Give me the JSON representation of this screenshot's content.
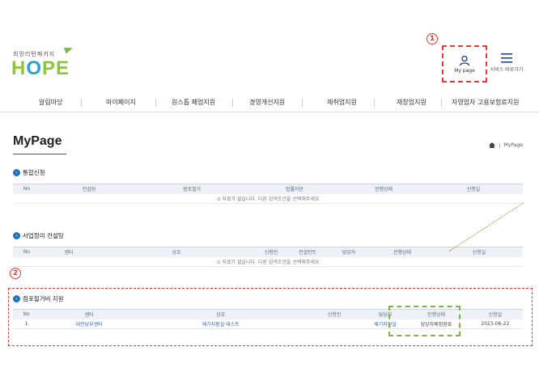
{
  "header": {
    "logo_sub": "희망리턴패키지",
    "logo_main_h": "H",
    "logo_main_o": "O",
    "logo_main_pe": "PE",
    "mypage_label": "My page",
    "menu_label": "서비스 바로가기"
  },
  "markers": {
    "one": "1",
    "two": "2"
  },
  "nav": [
    "알림마당",
    "마이페이지",
    "원스톱 폐업지원",
    "경영개선지원",
    "재취업지원",
    "재창업지원",
    "자영업자 고용보험료지원"
  ],
  "page": {
    "title": "MyPage",
    "breadcrumb_home": "home-icon",
    "breadcrumb_current": "MyPage"
  },
  "sections": {
    "integrated": {
      "title": "통합신청",
      "columns": [
        "No",
        "컨설팅",
        "점포철거",
        "법률자문",
        "진행상태",
        "신청일"
      ],
      "empty": "⊙ 자료가 없습니다. 다른 검색조건을 선택해주세요"
    },
    "consulting": {
      "title": "사업정리 컨설팅",
      "columns": [
        "No",
        "센터",
        "상호",
        "신청인",
        "컨설턴트",
        "담당자",
        "진행상태",
        "신청일"
      ],
      "empty": "⊙ 자료가 없습니다. 다른 검색조건을 선택해주세요"
    },
    "demolition": {
      "title": "점포철거비 지원",
      "columns": [
        "No",
        "센터",
        "상호",
        "신청인",
        "담당자",
        "진행상태",
        "신청일"
      ],
      "rows": [
        {
          "no": "1",
          "center": "대전남부센터",
          "name": "재기지원실 테스트",
          "applicant": "",
          "manager": "재기지원실",
          "status": "담당자배정완료",
          "date": "2023-06-22"
        }
      ]
    }
  },
  "colors": {
    "accent": "#1e73be",
    "annotation_red": "#e53935",
    "annotation_green": "#7cb342",
    "logo_green": "#8cc63f"
  }
}
